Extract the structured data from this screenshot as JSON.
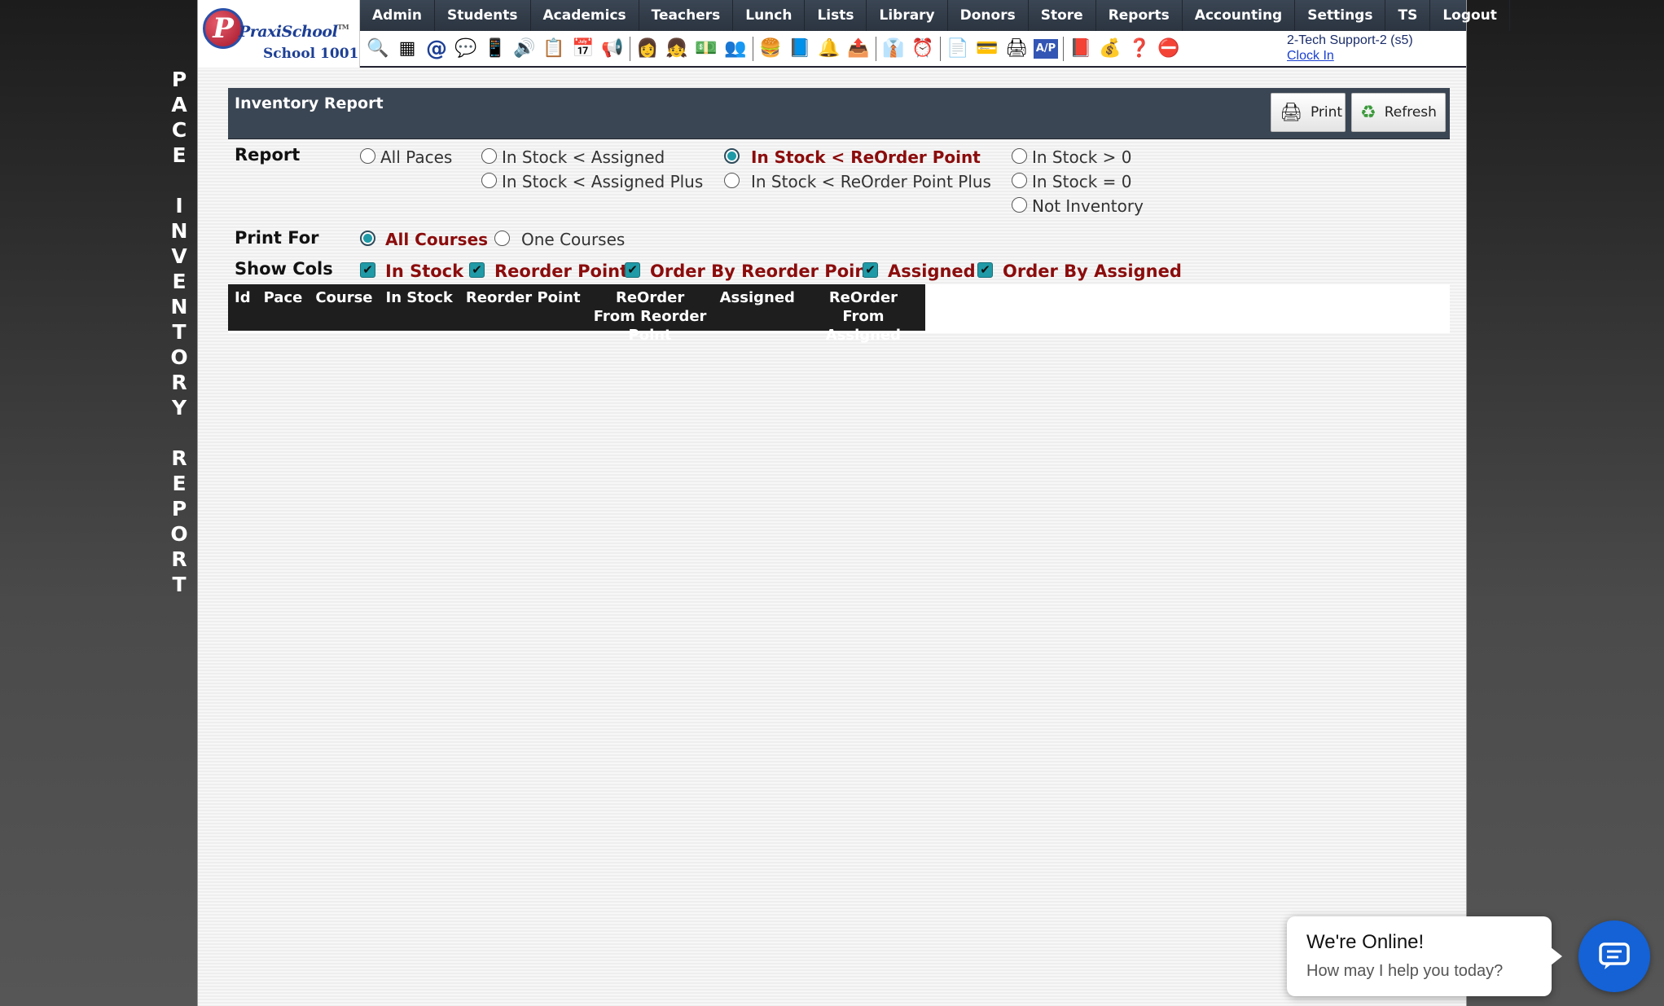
{
  "side_title": [
    "P",
    "A",
    "C",
    "E",
    " ",
    "I",
    "N",
    "V",
    "E",
    "N",
    "T",
    "O",
    "R",
    "Y",
    " ",
    "R",
    "E",
    "P",
    "O",
    "R",
    "T"
  ],
  "logo": {
    "brand": "PraxiSchool",
    "tm": "TM",
    "school": "School 1001"
  },
  "nav": [
    "Admin",
    "Students",
    "Academics",
    "Teachers",
    "Lunch",
    "Lists",
    "Library",
    "Donors",
    "Store",
    "Reports",
    "Accounting",
    "Settings",
    "TS",
    "Logout"
  ],
  "toolbar_icons": [
    {
      "name": "search-icon",
      "glyph": "🔍"
    },
    {
      "name": "grid-icon",
      "glyph": "▦"
    },
    {
      "name": "email-icon",
      "glyph": "@"
    },
    {
      "name": "chat-icon",
      "glyph": "💬"
    },
    {
      "name": "phone-icon",
      "glyph": "📱"
    },
    {
      "name": "speaker-icon",
      "glyph": "🔊"
    },
    {
      "name": "calendar-grid-icon",
      "glyph": "📋"
    },
    {
      "name": "calendar-icon",
      "glyph": "📅"
    },
    {
      "name": "megaphone-icon",
      "glyph": "📢"
    },
    {
      "name": "sep"
    },
    {
      "name": "teacher-icon",
      "glyph": "👩"
    },
    {
      "name": "student-icon",
      "glyph": "👧"
    },
    {
      "name": "money-icon",
      "glyph": "💵"
    },
    {
      "name": "users-icon",
      "glyph": "👥"
    },
    {
      "name": "sep"
    },
    {
      "name": "lunch-icon",
      "glyph": "🍔"
    },
    {
      "name": "book-icon",
      "glyph": "📘"
    },
    {
      "name": "bell-icon",
      "glyph": "🔔"
    },
    {
      "name": "export-icon",
      "glyph": "📤"
    },
    {
      "name": "sep"
    },
    {
      "name": "staff-icon",
      "glyph": "👔"
    },
    {
      "name": "clock-icon",
      "glyph": "⏰"
    },
    {
      "name": "sep"
    },
    {
      "name": "list-icon",
      "glyph": "📄"
    },
    {
      "name": "card-icon",
      "glyph": "💳"
    },
    {
      "name": "printer-icon",
      "glyph": "🖨"
    },
    {
      "name": "ap-icon",
      "glyph": "A/P"
    },
    {
      "name": "sep"
    },
    {
      "name": "pdf-icon",
      "glyph": "📕"
    },
    {
      "name": "cash-register-icon",
      "glyph": "💰"
    },
    {
      "name": "help-icon",
      "glyph": "❓"
    },
    {
      "name": "alert-icon",
      "glyph": "⛔"
    }
  ],
  "user": {
    "name": "2-Tech Support-2 (s5)",
    "clock_in": "Clock In"
  },
  "panel": {
    "title": "Inventory Report",
    "print": "Print",
    "refresh": "Refresh"
  },
  "report": {
    "label": "Report",
    "options": {
      "all_paces": "All Paces",
      "in_stock_lt_assigned": "In Stock < Assigned",
      "in_stock_lt_assigned_plus": "In Stock < Assigned Plus",
      "in_stock_lt_reorder_point": "In Stock < ReOrder Point",
      "in_stock_lt_reorder_point_plus": "In Stock < ReOrder Point Plus",
      "in_stock_gt_0": "In Stock > 0",
      "in_stock_eq_0": "In Stock = 0",
      "not_inventory": "Not Inventory"
    },
    "selected": "in_stock_lt_reorder_point"
  },
  "print_for": {
    "label": "Print For",
    "all_courses": "All Courses",
    "one_courses": "One Courses",
    "selected": "all_courses"
  },
  "show_cols": {
    "label": "Show Cols",
    "in_stock": "In Stock",
    "reorder_point": "Reorder Point",
    "order_by_reorder_point": "Order By Reorder Point",
    "assigned": "Assigned",
    "order_by_assigned": "Order By Assigned"
  },
  "table": {
    "headers": [
      "Id",
      "Pace",
      "Course",
      "In Stock",
      "Reorder Point",
      "ReOrder From Reorder Point",
      "Assigned",
      "ReOrder From Assigned"
    ]
  },
  "chat": {
    "title": "We're Online!",
    "subtitle": "How may I help you today?"
  },
  "colors": {
    "nav_bg": "#3b4654",
    "selected_text": "#8b0c0c",
    "accent": "#1f9aa6",
    "chat_blue": "#1462d6"
  }
}
